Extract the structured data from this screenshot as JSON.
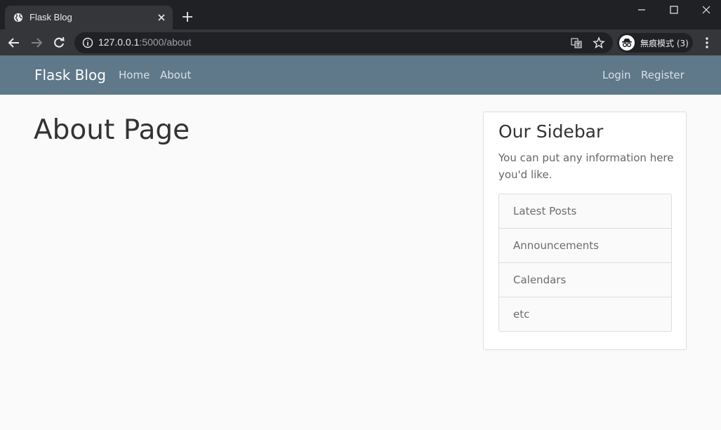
{
  "browser": {
    "tab_title": "Flask Blog",
    "url_host": "127.0.0.1",
    "url_rest": ":5000/about",
    "incognito_label": "無痕模式 (3)"
  },
  "navbar": {
    "brand": "Flask Blog",
    "links": [
      "Home",
      "About"
    ],
    "auth_links": [
      "Login",
      "Register"
    ]
  },
  "main": {
    "title": "About Page"
  },
  "sidebar": {
    "title": "Our Sidebar",
    "text": "You can put any information here you'd like.",
    "items": [
      "Latest Posts",
      "Announcements",
      "Calendars",
      "etc"
    ]
  },
  "colors": {
    "navbar_bg": "#5f788a",
    "chrome_dark": "#202124",
    "chrome_toolbar": "#35363a",
    "page_bg": "#fafafa"
  },
  "icons": [
    "globe-icon",
    "close-icon",
    "plus-icon",
    "minimize-icon",
    "maximize-icon",
    "back-icon",
    "forward-icon",
    "reload-icon",
    "info-icon",
    "translate-icon",
    "star-icon",
    "incognito-icon",
    "more-vertical-icon"
  ]
}
